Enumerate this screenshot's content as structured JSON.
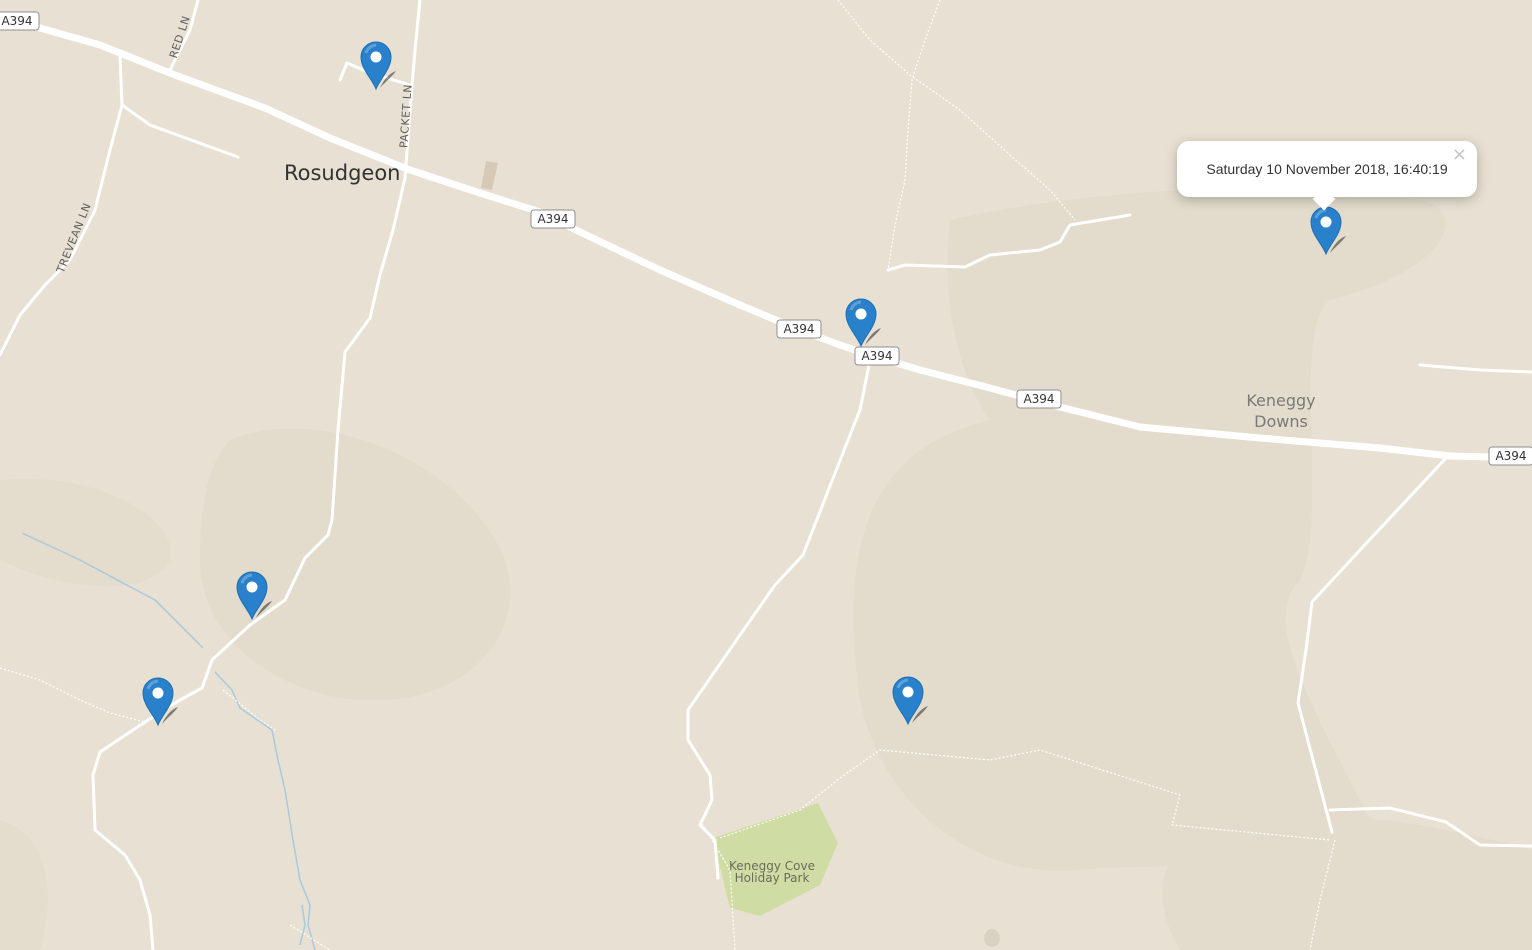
{
  "map": {
    "place_labels": {
      "rosudgeon": "Rosudgeon",
      "keneggy_downs_line1": "Keneggy",
      "keneggy_downs_line2": "Downs",
      "holiday_park_line1": "Keneggy Cove",
      "holiday_park_line2": "Holiday Park"
    },
    "road_shield": "A394",
    "lane_labels": {
      "red_ln": "RED LN",
      "packet_ln": "PACKET LN",
      "trevean_ln": "TREVEAN LN"
    },
    "colors": {
      "background": "#e8e1d3",
      "marker": "#2a81cb",
      "park": "#cfdda4",
      "water": "#a9c9dd"
    },
    "marker_count": 6
  },
  "popup": {
    "text": "Saturday 10 November 2018, 16:40:19",
    "close_glyph": "×"
  }
}
